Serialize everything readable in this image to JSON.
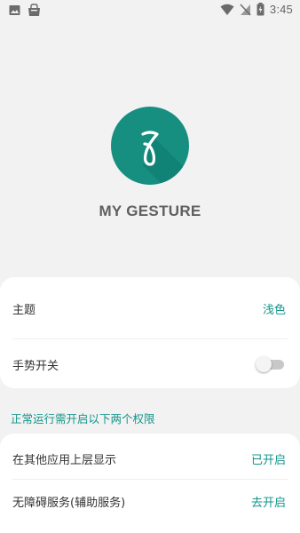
{
  "status_bar": {
    "time": "3:45",
    "left_icons": [
      "image-icon",
      "store-bag-icon"
    ],
    "right_icons": [
      "wifi-icon",
      "signal-off-icon",
      "battery-charging-icon"
    ]
  },
  "app": {
    "title": "MY GESTURE",
    "logo_icon": "gesture-logo-icon",
    "brand_color": "#168f80"
  },
  "settings": {
    "theme": {
      "label": "主题",
      "value": "浅色"
    },
    "gesture_switch": {
      "label": "手势开关",
      "enabled": false
    }
  },
  "permissions": {
    "header": "正常运行需开启以下两个权限",
    "overlay": {
      "label": "在其他应用上层显示",
      "status": "已开启"
    },
    "accessibility": {
      "label": "无障碍服务(辅助服务)",
      "status": "去开启"
    }
  },
  "colors": {
    "accent": "#13958a",
    "background": "#f2f2f2",
    "card": "#ffffff"
  }
}
